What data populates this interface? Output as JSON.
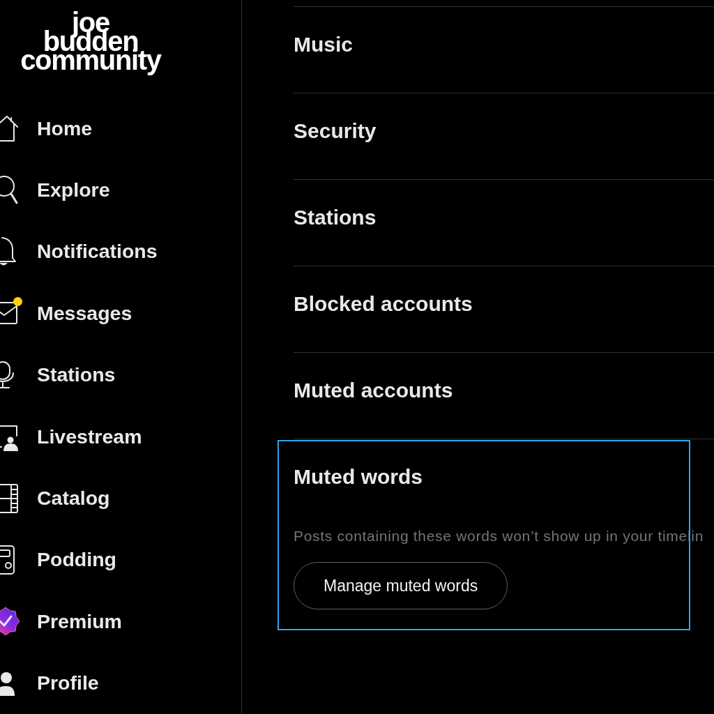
{
  "logo": {
    "lines": [
      "joe",
      "budden",
      "community"
    ]
  },
  "nav": [
    {
      "label": "Home",
      "unread": false
    },
    {
      "label": "Explore",
      "unread": false
    },
    {
      "label": "Notifications",
      "unread": false
    },
    {
      "label": "Messages",
      "unread": true
    },
    {
      "label": "Stations",
      "unread": false
    },
    {
      "label": "Livestream",
      "unread": false
    },
    {
      "label": "Catalog",
      "unread": false
    },
    {
      "label": "Podding",
      "unread": false
    },
    {
      "label": "Premium",
      "unread": false
    },
    {
      "label": "Profile",
      "unread": false
    }
  ],
  "settings": [
    {
      "title": "Music",
      "focused": false
    },
    {
      "title": "Security",
      "focused": false
    },
    {
      "title": "Stations",
      "focused": false
    },
    {
      "title": "Blocked accounts",
      "focused": false
    },
    {
      "title": "Muted accounts",
      "focused": false
    },
    {
      "title": "Muted words",
      "focused": true,
      "description": "Posts containing these words won’t show up in your timelin",
      "button": "Manage muted words"
    }
  ]
}
